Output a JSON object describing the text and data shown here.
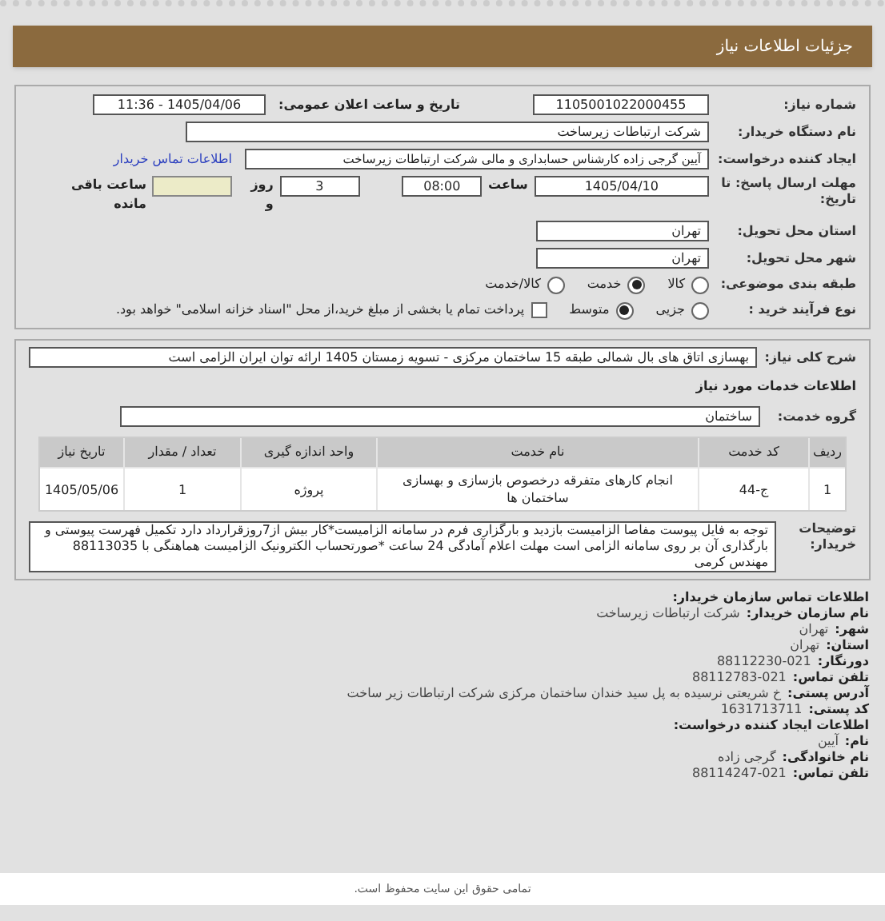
{
  "header": {
    "title": "جزئیات اطلاعات نیاز"
  },
  "need_number": {
    "label": "شماره نیاز:",
    "value": "1105001022000455"
  },
  "announce": {
    "label": "تاریخ و ساعت اعلان عمومی:",
    "value": "1405/04/06 - 11:36"
  },
  "buyer_org": {
    "label": "نام دستگاه خریدار:",
    "value": "شرکت ارتباطات زیرساخت"
  },
  "requester": {
    "label": "ایجاد کننده درخواست:",
    "value": "آیین گرجی زاده کارشناس حسابداری و مالی شرکت ارتباطات زیرساخت",
    "link": "اطلاعات تماس خریدار"
  },
  "deadline": {
    "label": "مهلت ارسال پاسخ: تا تاریخ:",
    "date": "1405/04/10",
    "time_label": "ساعت",
    "time": "08:00",
    "days": "3",
    "days_label": "روز و",
    "remaining_label": "ساعت باقی مانده"
  },
  "province": {
    "label": "استان محل تحویل:",
    "value": "تهران"
  },
  "city": {
    "label": "شهر محل تحویل:",
    "value": "تهران"
  },
  "category": {
    "label": "طبقه بندی موضوعی:",
    "options": [
      {
        "label": "کالا",
        "selected": false
      },
      {
        "label": "خدمت",
        "selected": true
      },
      {
        "label": "کالا/خدمت",
        "selected": false
      }
    ]
  },
  "process": {
    "label": "نوع فرآیند خرید :",
    "options": [
      {
        "label": "جزیی",
        "selected": false
      },
      {
        "label": "متوسط",
        "selected": true
      }
    ],
    "payment": {
      "checked": false,
      "text": "پرداخت تمام یا بخشی از مبلغ خرید،از محل \"اسناد خزانه اسلامی\" خواهد بود."
    }
  },
  "summary": {
    "label": "شرح کلی نیاز:",
    "value": "بهسازی اتاق های بال شمالی طبقه 15 ساختمان مرکزی - تسویه زمستان 1405 ارائه توان ایران الزامی است"
  },
  "services_title": "اطلاعات خدمات مورد نیاز",
  "service_group": {
    "label": "گروه خدمت:",
    "value": "ساختمان"
  },
  "table": {
    "columns": [
      "ردیف",
      "کد خدمت",
      "نام خدمت",
      "واحد اندازه گیری",
      "تعداد / مقدار",
      "تاریخ نیاز"
    ],
    "rows": [
      [
        "1",
        "ج-44",
        "انجام کارهای متفرقه درخصوص بازسازی و بهسازی ساختمان ها",
        "پروژه",
        "1",
        "1405/05/06"
      ]
    ]
  },
  "buyer_notes": {
    "label": "توضیحات خریدار:",
    "value": "توجه به فایل پیوست مفاصا الزامیست بازدید و بارگزاری فرم در سامانه الزامیست*کار بیش از7روزقرارداد دارد تکمیل فهرست پیوستی و بارگذاری آن بر روی سامانه الزامی است مهلت اعلام آمادگی 24 ساعت *صورتحساب الکترونیک الزامیست هماهنگی با 88113035 مهندس کرمی"
  },
  "contact": [
    {
      "kind": "heading",
      "label": "اطلاعات تماس سازمان خریدار:"
    },
    {
      "kind": "field",
      "label": "نام سازمان خریدار:",
      "value": "شرکت ارتباطات زیرساخت"
    },
    {
      "kind": "field",
      "label": "شهر:",
      "value": "تهران"
    },
    {
      "kind": "field",
      "label": "استان:",
      "value": "تهران"
    },
    {
      "kind": "field",
      "label": "دورنگار:",
      "value": "88112230-021"
    },
    {
      "kind": "field",
      "label": "تلفن تماس:",
      "value": "88112783-021"
    },
    {
      "kind": "field",
      "label": "آدرس پستی:",
      "value": "خ شریعتی نرسیده به پل سید خندان ساختمان مرکزی شرکت ارتباطات زیر ساخت"
    },
    {
      "kind": "field",
      "label": "کد پستی:",
      "value": "1631713711"
    },
    {
      "kind": "heading",
      "label": "اطلاعات ایجاد کننده درخواست:"
    },
    {
      "kind": "field",
      "label": "نام:",
      "value": "آیین"
    },
    {
      "kind": "field",
      "label": "نام خانوادگی:",
      "value": "گرجی زاده"
    },
    {
      "kind": "field",
      "label": "تلفن تماس:",
      "value": "88114247-021"
    }
  ],
  "footer": "تمامی حقوق این سایت محفوظ است."
}
